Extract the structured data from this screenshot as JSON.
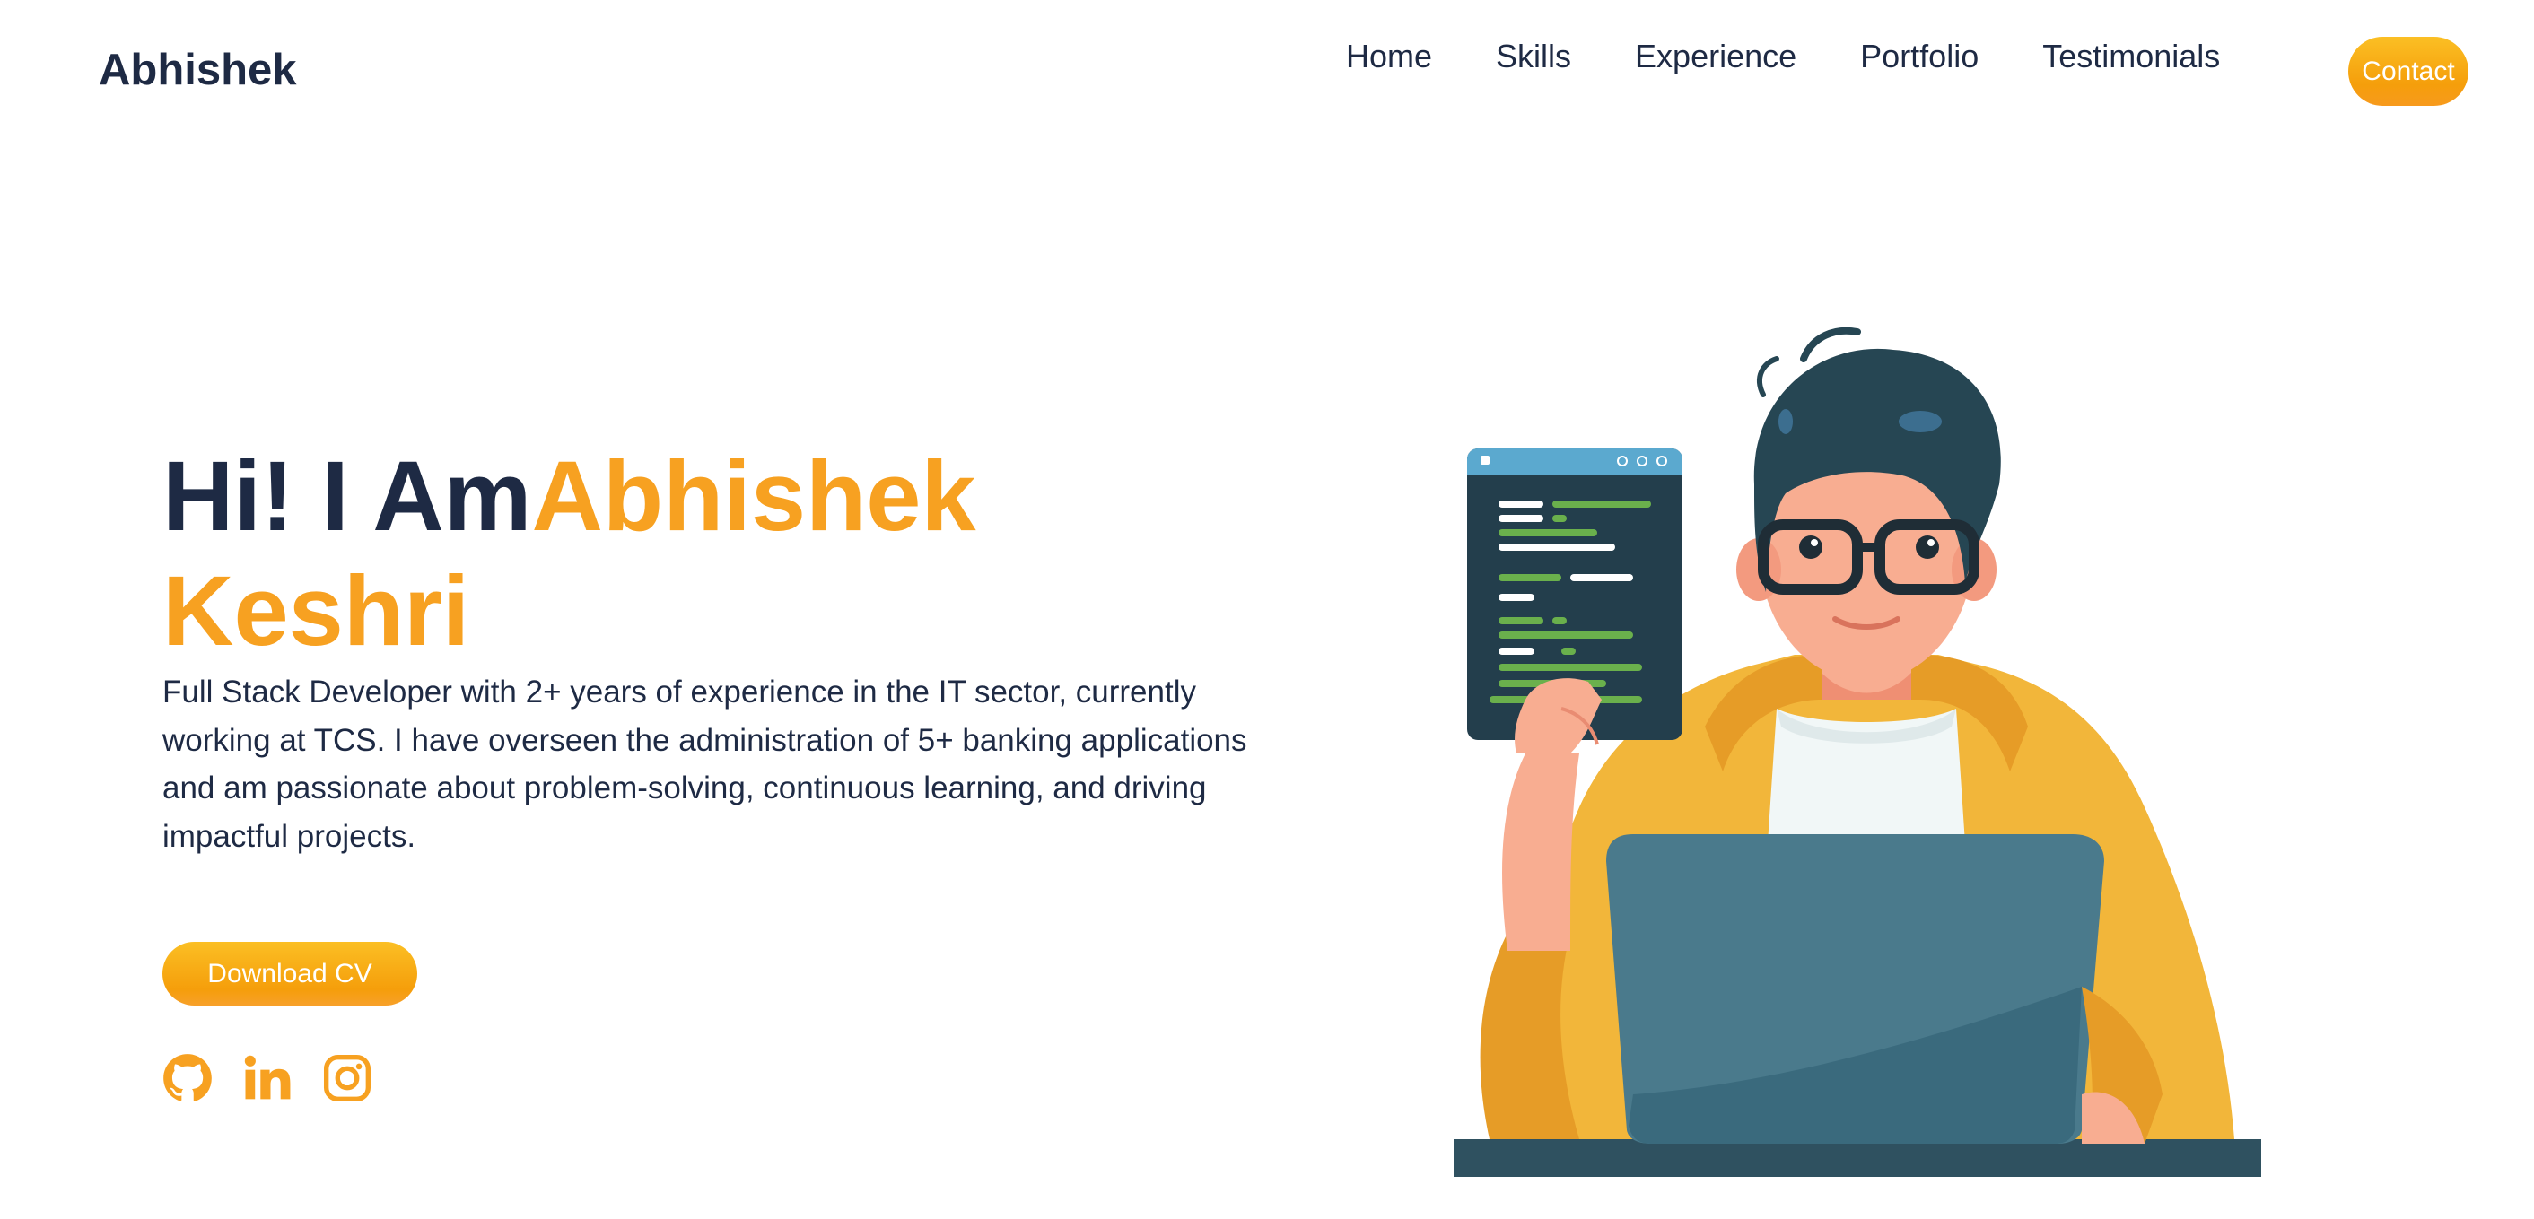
{
  "header": {
    "brand": "Abhishek",
    "nav": [
      {
        "label": "Home"
      },
      {
        "label": "Skills"
      },
      {
        "label": "Experience"
      },
      {
        "label": "Portfolio"
      },
      {
        "label": "Testimonials"
      }
    ],
    "contact_label": "Contact"
  },
  "hero": {
    "greeting": "Hi! I Am",
    "first_name": "Abhishek",
    "last_name": "Keshri",
    "description": "Full Stack Developer with 2+ years of experience in the IT sector, currently working at TCS. I have overseen the administration of 5+ banking applications and am passionate about problem-solving, continuous learning, and driving impactful projects.",
    "cv_label": "Download CV"
  },
  "socials": [
    {
      "icon": "github-icon"
    },
    {
      "icon": "linkedin-icon"
    },
    {
      "icon": "instagram-icon"
    }
  ],
  "colors": {
    "accent": "#f7a121",
    "text": "#1e2a44",
    "button": "#fbbf24"
  }
}
